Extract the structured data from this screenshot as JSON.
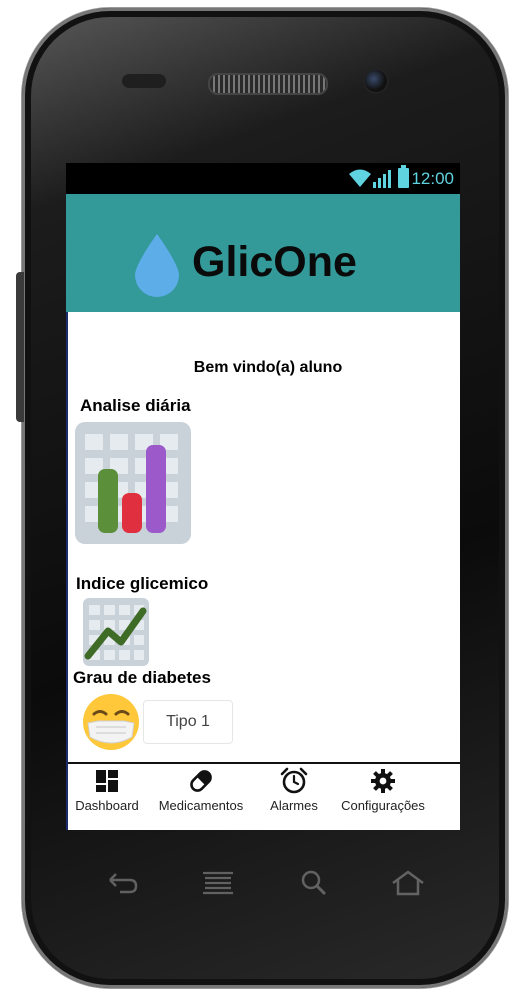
{
  "statusbar": {
    "time": "12:00"
  },
  "app": {
    "title": "GlicOne"
  },
  "main": {
    "welcome": "Bem vindo(a) aluno",
    "analise_label": "Analise diária",
    "indice_label": "Indice glicemico",
    "grau_label": "Grau de diabetes",
    "grau_value": "Tipo 1"
  },
  "nav": {
    "items": [
      {
        "label": "Dashboard",
        "icon": "dashboard-icon"
      },
      {
        "label": "Medicamentos",
        "icon": "pill-icon"
      },
      {
        "label": "Alarmes",
        "icon": "alarm-clock-icon"
      },
      {
        "label": "Configurações",
        "icon": "gear-icon"
      }
    ]
  },
  "colors": {
    "appbar": "#339999",
    "drop": "#5dade8",
    "accent": "#5fd3df",
    "bar_green": "#5b8f3a",
    "bar_red": "#e0303f",
    "bar_purple": "#9b59c9"
  }
}
